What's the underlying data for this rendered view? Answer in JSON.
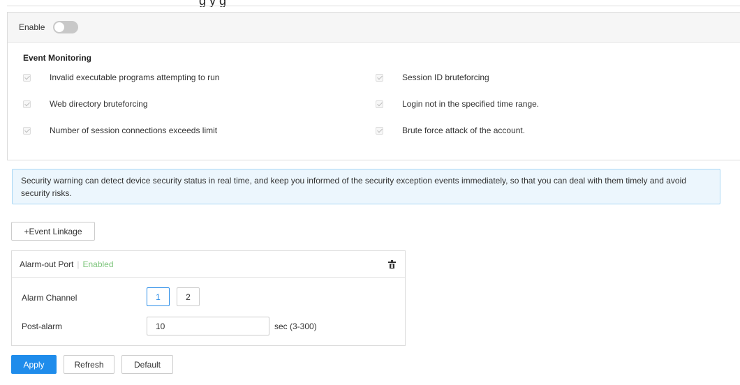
{
  "page_heading_fragment": "g             y     g",
  "enable": {
    "label": "Enable",
    "state": "off"
  },
  "event_monitoring": {
    "title": "Event Monitoring",
    "items_left": [
      "Invalid executable programs attempting to run",
      "Web directory bruteforcing",
      "Number of session connections exceeds limit"
    ],
    "items_right": [
      "Session ID bruteforcing",
      "Login not in the specified time range.",
      "Brute force attack of the account."
    ]
  },
  "info_text": "Security warning can detect device security status in real time, and keep you informed of the security exception events immediately, so that you can deal with them timely and avoid security risks.",
  "event_linkage_button": "+Event Linkage",
  "linkage": {
    "title": "Alarm-out Port",
    "separator": "|",
    "status": "Enabled",
    "alarm_channel_label": "Alarm Channel",
    "channels": [
      "1",
      "2"
    ],
    "selected_channel": "1",
    "post_alarm_label": "Post-alarm",
    "post_alarm_value": "10",
    "post_alarm_unit": "sec (3-300)"
  },
  "actions": {
    "apply": "Apply",
    "refresh": "Refresh",
    "default": "Default"
  },
  "colors": {
    "primary": "#1f8ceb",
    "enabled_status": "#7cc47a",
    "info_bg": "#ecf6fd",
    "info_border": "#a9d7f5",
    "toggle_off": "#c8c8c8"
  }
}
